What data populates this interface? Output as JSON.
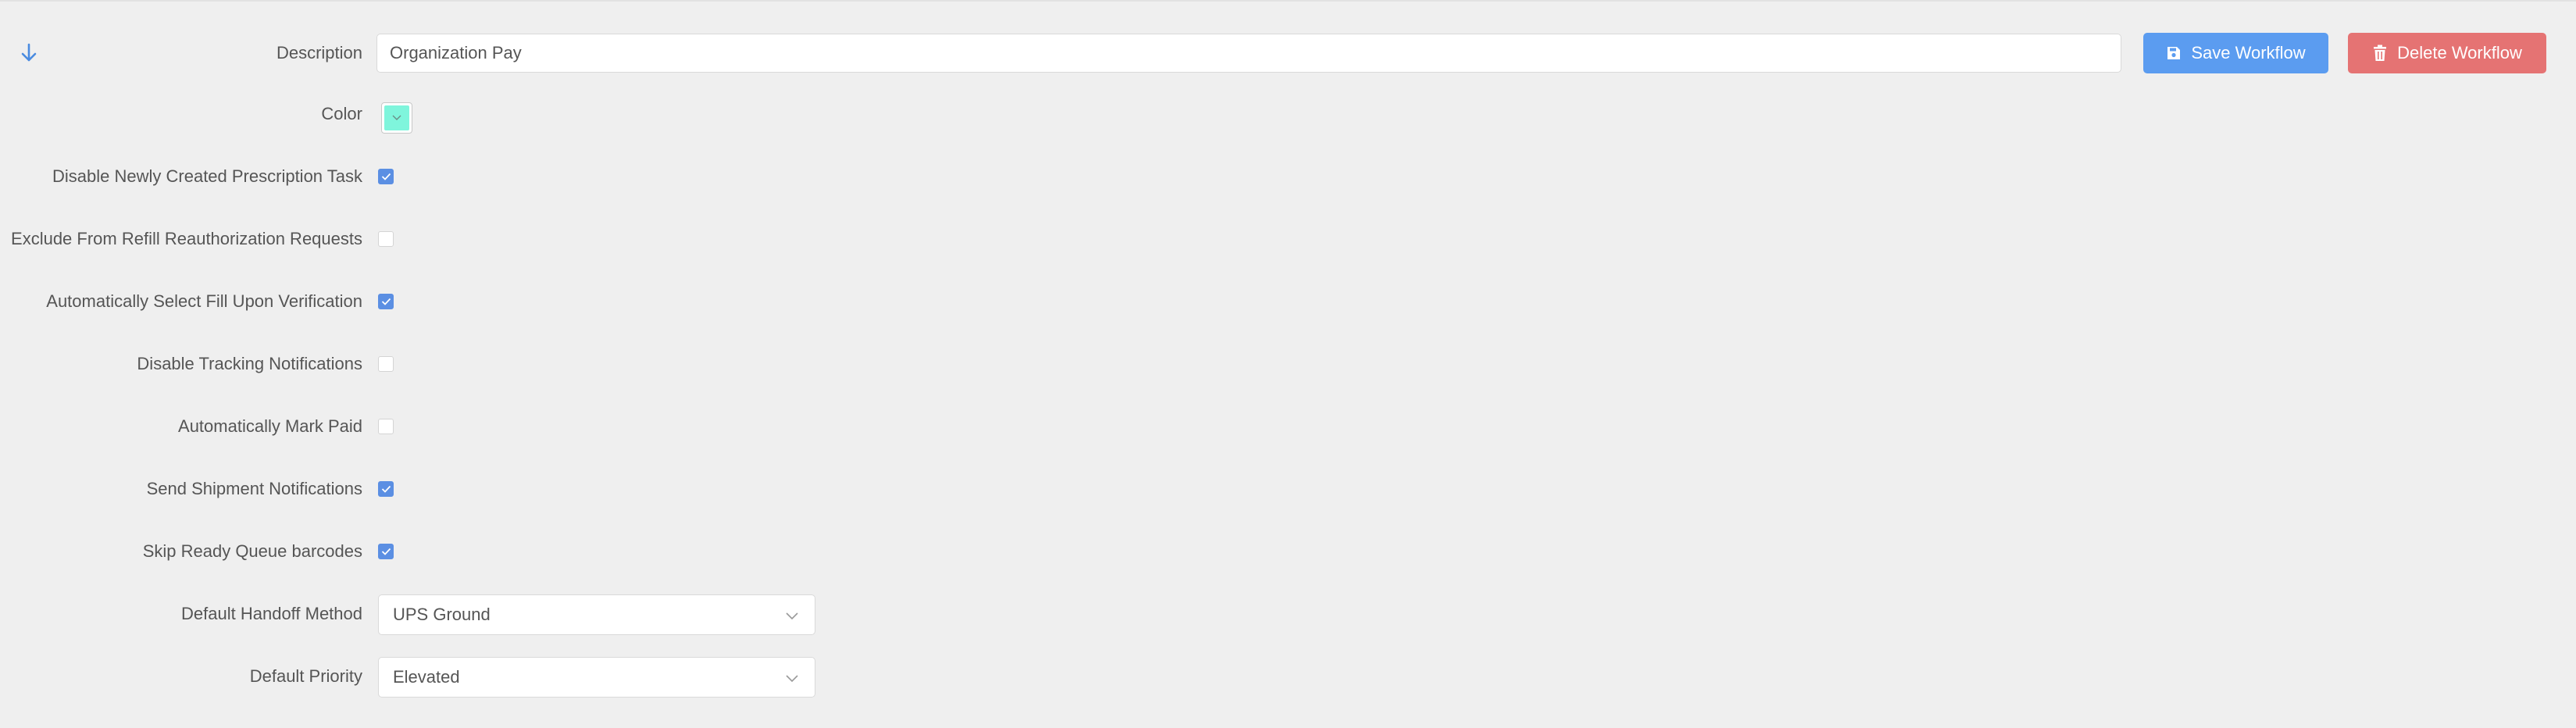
{
  "form": {
    "description": {
      "label": "Description",
      "value": "Organization Pay"
    },
    "color": {
      "label": "Color",
      "value": "#7ff5dc"
    },
    "checkboxes": [
      {
        "label": "Disable Newly Created Prescription Task",
        "checked": true
      },
      {
        "label": "Exclude From Refill Reauthorization Requests",
        "checked": false
      },
      {
        "label": "Automatically Select Fill Upon Verification",
        "checked": true
      },
      {
        "label": "Disable Tracking Notifications",
        "checked": false
      },
      {
        "label": "Automatically Mark Paid",
        "checked": false
      },
      {
        "label": "Send Shipment Notifications",
        "checked": true
      },
      {
        "label": "Skip Ready Queue barcodes",
        "checked": true
      }
    ],
    "handoff": {
      "label": "Default Handoff Method",
      "value": "UPS Ground"
    },
    "priority": {
      "label": "Default Priority",
      "value": "Elevated"
    }
  },
  "actions": {
    "save_label": "Save Workflow",
    "delete_label": "Delete Workflow"
  },
  "icons": {
    "collapse": "arrow-down-icon",
    "save": "floppy-disk-icon",
    "delete": "trash-icon",
    "dropdown": "chevron-down-icon",
    "check": "checkmark-icon"
  },
  "colors": {
    "save_button": "#5b9cf0",
    "delete_button": "#e57373",
    "checkbox_checked": "#5b8fe3",
    "arrow": "#4a8be0"
  }
}
